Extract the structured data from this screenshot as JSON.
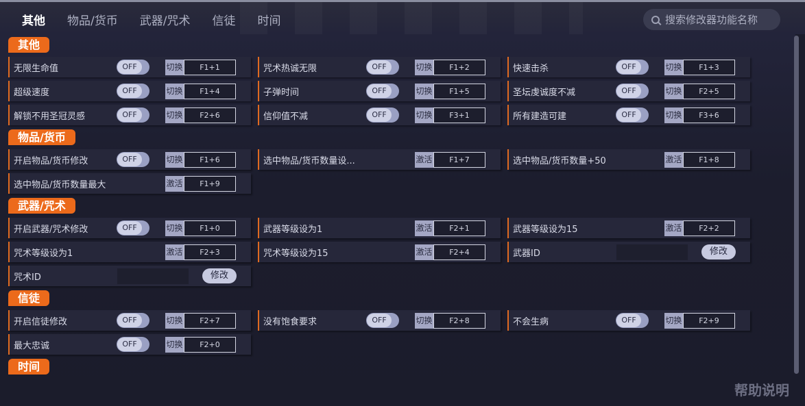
{
  "tabs": [
    "其他",
    "物品/货币",
    "武器/咒术",
    "信徒",
    "时间"
  ],
  "search": {
    "placeholder": "搜索修改器功能名称"
  },
  "sections": {
    "other": "其他",
    "items": "物品/货币",
    "weapons": "武器/咒术",
    "followers": "信徒",
    "time": "时间"
  },
  "labels": {
    "toggle_off": "OFF",
    "mode_switch": "切换",
    "mode_activate": "激活",
    "edit": "修改"
  },
  "cheats": {
    "other": [
      {
        "label": "无限生命值",
        "key": "F1+1"
      },
      {
        "label": "咒术热诚无限",
        "key": "F1+2"
      },
      {
        "label": "快速击杀",
        "key": "F1+3"
      },
      {
        "label": "超级速度",
        "key": "F1+4"
      },
      {
        "label": "子弹时间",
        "key": "F1+5"
      },
      {
        "label": "圣坛虔诚度不减",
        "key": "F2+5"
      },
      {
        "label": "解锁不用圣冠灵感",
        "key": "F2+6"
      },
      {
        "label": "信仰值不减",
        "key": "F3+1"
      },
      {
        "label": "所有建造可建",
        "key": "F3+6"
      }
    ],
    "items": [
      {
        "label": "开启物品/货币修改",
        "key": "F1+6"
      },
      {
        "label": "选中物品/货币数量设...",
        "key": "F1+7"
      },
      {
        "label": "选中物品/货币数量+50",
        "key": "F1+8"
      },
      {
        "label": "选中物品/货币数量最大",
        "key": "F1+9"
      }
    ],
    "weapons": [
      {
        "label": "开启武器/咒术修改",
        "key": "F1+0"
      },
      {
        "label": "武器等级设为1",
        "key": "F2+1"
      },
      {
        "label": "武器等级设为15",
        "key": "F2+2"
      },
      {
        "label": "咒术等级设为1",
        "key": "F2+3"
      },
      {
        "label": "咒术等级设为15",
        "key": "F2+4"
      },
      {
        "label": "武器ID"
      },
      {
        "label": "咒术ID"
      }
    ],
    "followers": [
      {
        "label": "开启信徒修改",
        "key": "F2+7"
      },
      {
        "label": "没有饱食要求",
        "key": "F2+8"
      },
      {
        "label": "不会生病",
        "key": "F2+9"
      },
      {
        "label": "最大忠诚",
        "key": "F2+0"
      }
    ]
  },
  "help": "帮助说明"
}
